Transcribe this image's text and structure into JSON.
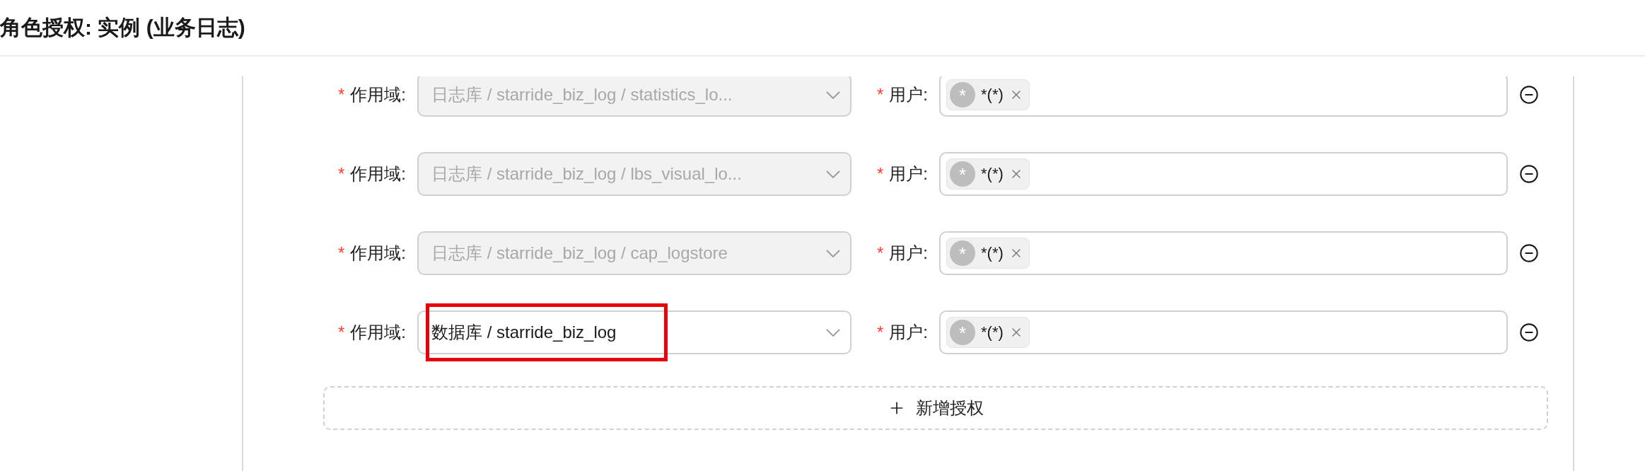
{
  "title": "角色授权: 实例 (业务日志)",
  "rules": [
    {
      "mark": "*",
      "scope_label": "作用域:",
      "scope_value": "日志库 / starride_biz_log / statistics_lo...",
      "disabled": true,
      "highlighted": false,
      "user_label": "用户:",
      "users": [
        {
          "avatar": "*",
          "name": "*(*)"
        }
      ]
    },
    {
      "mark": "*",
      "scope_label": "作用域:",
      "scope_value": "日志库 / starride_biz_log / lbs_visual_lo...",
      "disabled": true,
      "highlighted": false,
      "user_label": "用户:",
      "users": [
        {
          "avatar": "*",
          "name": "*(*)"
        }
      ]
    },
    {
      "mark": "*",
      "scope_label": "作用域:",
      "scope_value": "日志库 / starride_biz_log / cap_logstore",
      "disabled": true,
      "highlighted": false,
      "user_label": "用户:",
      "users": [
        {
          "avatar": "*",
          "name": "*(*)"
        }
      ]
    },
    {
      "mark": "*",
      "scope_label": "作用域:",
      "scope_value": "数据库 / starride_biz_log",
      "disabled": false,
      "highlighted": true,
      "user_label": "用户:",
      "users": [
        {
          "avatar": "*",
          "name": "*(*)"
        }
      ]
    }
  ],
  "add_button": "新增授权"
}
